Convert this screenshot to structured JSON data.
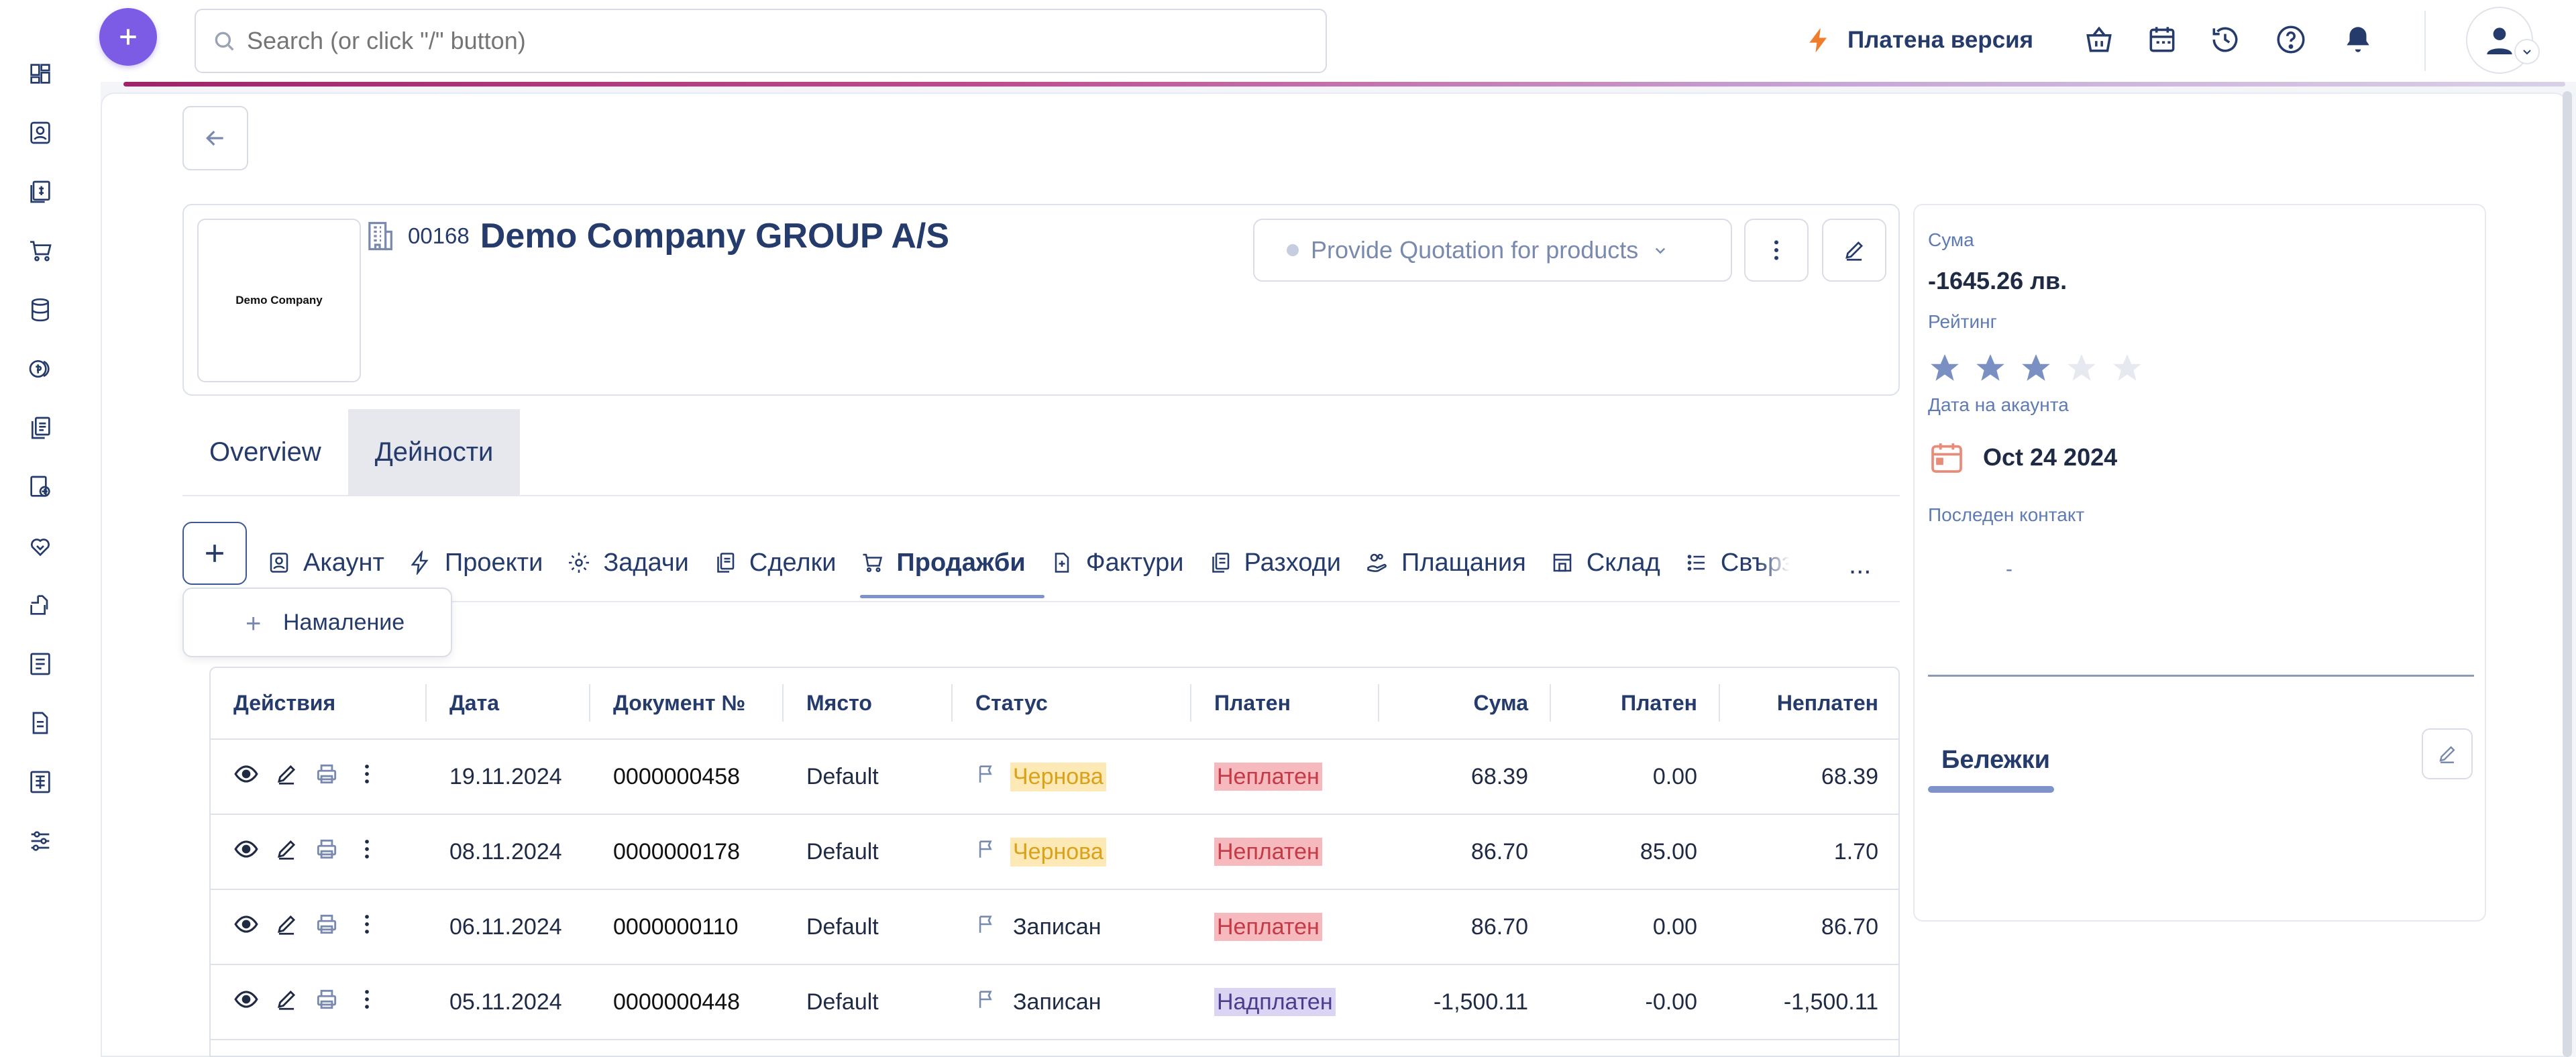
{
  "search": {
    "placeholder": "Search (or click \"/\" button)"
  },
  "topbar": {
    "paid_label": "Платена версия"
  },
  "colors": {
    "accent": "#7c5ce4",
    "navy": "#243b6b",
    "draft_bg": "#fde9b5",
    "draft_fg": "#d9a21a",
    "unpaid_bg": "#f6b9bd",
    "unpaid_fg": "#c43a45",
    "overpaid_bg": "#dcd4f3",
    "overpaid_fg": "#4a3d8c",
    "star_on": "#7a90c2",
    "star_off": "#e6e9ef"
  },
  "company": {
    "logo_text": "Demo Company",
    "code": "00168",
    "name": "Demo Company GROUP A/S",
    "stage": "Provide Quotation for products"
  },
  "main_tabs": [
    "Overview",
    "Дейности"
  ],
  "module_tabs": [
    {
      "label": "Акаунт",
      "icon": "account-icon"
    },
    {
      "label": "Проекти",
      "icon": "bolt-icon"
    },
    {
      "label": "Задачи",
      "icon": "gear-icon"
    },
    {
      "label": "Сделки",
      "icon": "documents-icon"
    },
    {
      "label": "Продажби",
      "icon": "cart-icon"
    },
    {
      "label": "Фактури",
      "icon": "invoice-icon"
    },
    {
      "label": "Разходи",
      "icon": "expenses-icon"
    },
    {
      "label": "Плащания",
      "icon": "payments-icon"
    },
    {
      "label": "Склад",
      "icon": "warehouse-icon"
    },
    {
      "label": "Свързани",
      "icon": "list-icon"
    }
  ],
  "more_label": "...",
  "dropdown": {
    "item": "Намаление"
  },
  "table": {
    "headers": [
      "Действия",
      "Дата",
      "Документ №",
      "Място",
      "Статус",
      "Платен",
      "Сума",
      "Платен",
      "Неплатен"
    ],
    "rows": [
      {
        "date": "19.11.2024",
        "doc": "0000000458",
        "place": "Default",
        "status": "Чернова",
        "paid_status": "Неплатен",
        "sum": "68.39",
        "paid": "0.00",
        "unpaid": "68.39"
      },
      {
        "date": "08.11.2024",
        "doc": "0000000178",
        "place": "Default",
        "status": "Чернова",
        "paid_status": "Неплатен",
        "sum": "86.70",
        "paid": "85.00",
        "unpaid": "1.70"
      },
      {
        "date": "06.11.2024",
        "doc": "0000000110",
        "place": "Default",
        "status": "Записан",
        "paid_status": "Неплатен",
        "sum": "86.70",
        "paid": "0.00",
        "unpaid": "86.70"
      },
      {
        "date": "05.11.2024",
        "doc": "0000000448",
        "place": "Default",
        "status": "Записан",
        "paid_status": "Надплатен",
        "sum": "-1,500.11",
        "paid": "-0.00",
        "unpaid": "-1,500.11"
      }
    ]
  },
  "summary": {
    "sum_label": "Сума",
    "sum_value": "-1645.26 лв.",
    "rating_label": "Рейтинг",
    "rating": 3,
    "rating_max": 5,
    "date_label": "Дата на акаунта",
    "date_value": "Oct 24 2024",
    "last_contact_label": "Последен контакт",
    "last_contact_value": "-",
    "notes_label": "Бележки"
  }
}
